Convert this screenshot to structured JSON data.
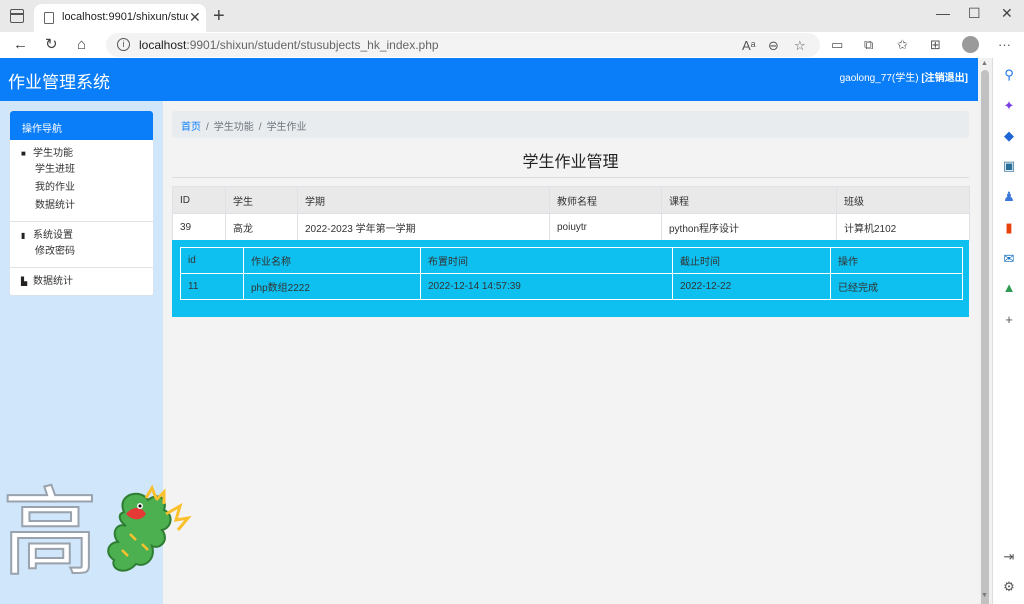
{
  "browser": {
    "tab_title": "localhost:9901/shixun/student/stusubjects_hk_index.php",
    "url_host": "localhost",
    "url_rest": ":9901/shixun/student/stusubjects_hk_index.php"
  },
  "app": {
    "title": "作业管理系统",
    "user": "gaolong_77(学生)",
    "logout": "[注销退出]"
  },
  "nav": {
    "header": "操作导航",
    "groups": [
      {
        "title": "学生功能",
        "icon": "user-icon",
        "items": [
          "学生进班",
          "我的作业",
          "数据统计"
        ]
      },
      {
        "title": "系统设置",
        "icon": "bookmark-icon",
        "items": [
          "修改密码"
        ]
      },
      {
        "title": "数据统计",
        "icon": "bar-chart-icon",
        "items": []
      }
    ]
  },
  "breadcrumb": [
    "首页",
    "学生功能",
    "学生作业"
  ],
  "page_title": "学生作业管理",
  "subject_table": {
    "columns": [
      "ID",
      "学生",
      "学期",
      "教师名程",
      "课程",
      "班级"
    ],
    "rows": [
      [
        "39",
        "高龙",
        "2022-2023 学年第一学期",
        "poiuytr",
        "python程序设计",
        "计算机2102"
      ]
    ]
  },
  "homework_table": {
    "columns": [
      "id",
      "作业名称",
      "布置时间",
      "截止时间",
      "操作"
    ],
    "rows": [
      [
        "11",
        "php数组2222",
        "2022-12-14 14:57:39",
        "2022-12-22",
        "已经完成"
      ]
    ]
  },
  "overlay": {
    "watermark_char": "高"
  },
  "colors": {
    "header_blue": "#0a7df9",
    "detail_cyan": "#0dc0ef",
    "sidebar_bg": "#cfe6fb"
  }
}
